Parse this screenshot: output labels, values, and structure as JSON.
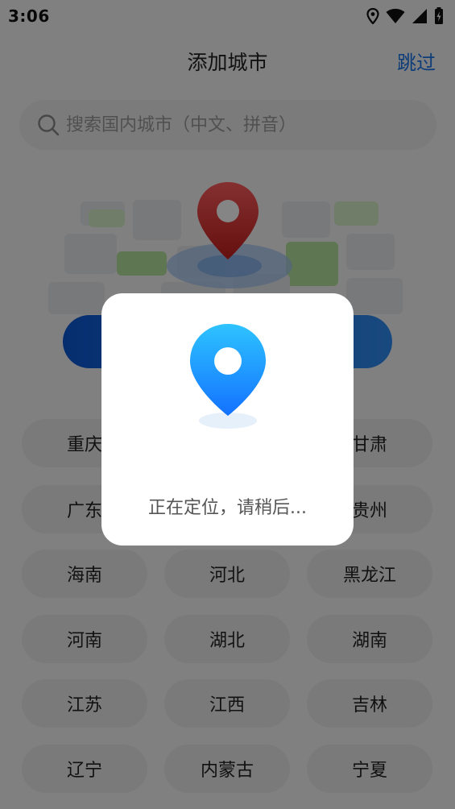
{
  "status_bar": {
    "time": "3:06"
  },
  "header": {
    "title": "添加城市",
    "skip_label": "跳过"
  },
  "search": {
    "placeholder": "搜索国内城市（中文、拼音）"
  },
  "provinces": [
    "重庆",
    "",
    "甘肃",
    "广东",
    "",
    "贵州",
    "海南",
    "河北",
    "黑龙江",
    "河南",
    "湖北",
    "湖南",
    "江苏",
    "江西",
    "吉林",
    "辽宁",
    "内蒙古",
    "宁夏"
  ],
  "dialog": {
    "message": "正在定位，请稍后..."
  },
  "colors": {
    "accent": "#1a73e8",
    "pin_red": "#d93a3a",
    "pin_blue": "#1a8cff"
  }
}
